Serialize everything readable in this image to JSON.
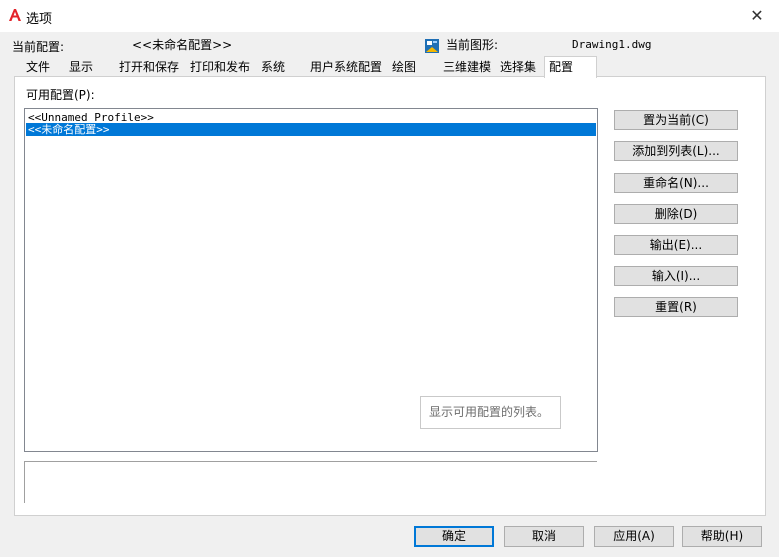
{
  "window": {
    "title": "选项",
    "close_glyph": "✕"
  },
  "header": {
    "current_profile_label": "当前配置:",
    "current_profile_value": "<<未命名配置>>",
    "current_drawing_label": "当前图形:",
    "current_drawing_value": "Drawing1.dwg",
    "drawing_icon": "drawing-file-icon"
  },
  "tabs": [
    {
      "label": "文件"
    },
    {
      "label": "显示"
    },
    {
      "label": "打开和保存"
    },
    {
      "label": "打印和发布"
    },
    {
      "label": "系统"
    },
    {
      "label": "用户系统配置"
    },
    {
      "label": "绘图"
    },
    {
      "label": "三维建模"
    },
    {
      "label": "选择集"
    },
    {
      "label": "配置",
      "active": true
    }
  ],
  "profiles": {
    "label": "可用配置(P):",
    "items": [
      {
        "name": "<<Unnamed Profile>>",
        "selected": false
      },
      {
        "name": "<<未命名配置>>",
        "selected": true
      }
    ],
    "tooltip": "显示可用配置的列表。"
  },
  "side_buttons": [
    {
      "label": "置为当前(C)"
    },
    {
      "label": "添加到列表(L)..."
    },
    {
      "label": "重命名(N)..."
    },
    {
      "label": "删除(D)"
    },
    {
      "label": "输出(E)..."
    },
    {
      "label": "输入(I)..."
    },
    {
      "label": "重置(R)"
    }
  ],
  "footer_buttons": [
    {
      "label": "确定",
      "default": true
    },
    {
      "label": "取消"
    },
    {
      "label": "应用(A)"
    },
    {
      "label": "帮助(H)"
    }
  ],
  "colors": {
    "selection": "#0078d7",
    "logo_red": "#e3242b"
  }
}
